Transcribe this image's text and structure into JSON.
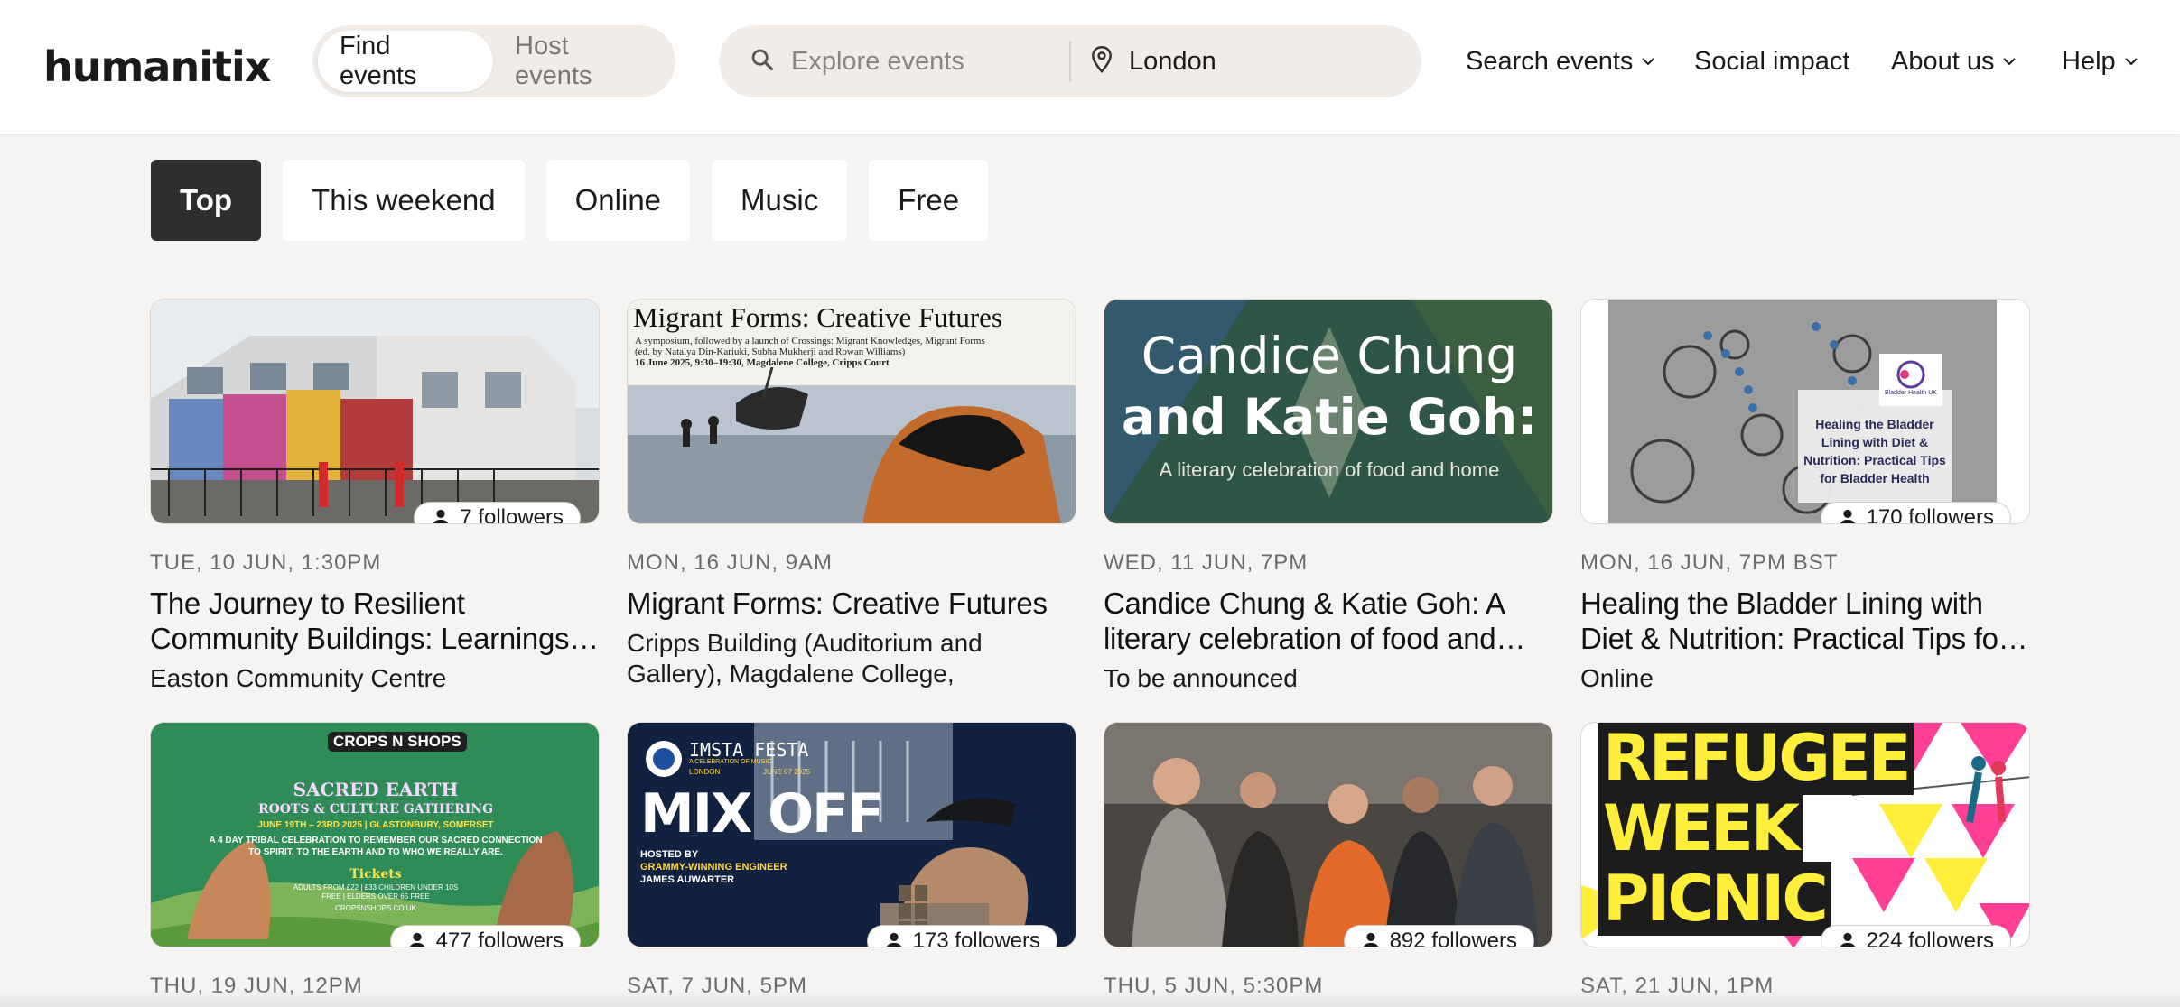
{
  "brand": {
    "logo_text": "humanitix"
  },
  "header": {
    "toggle": {
      "find": "Find events",
      "host": "Host events"
    },
    "search": {
      "placeholder": "Explore events",
      "location": "London"
    },
    "nav": {
      "search_events": "Search events",
      "social_impact": "Social impact",
      "about_us": "About us",
      "help": "Help"
    }
  },
  "filters": [
    "Top",
    "This weekend",
    "Online",
    "Music",
    "Free"
  ],
  "events": [
    {
      "date": "TUE, 10 JUN, 1:30PM",
      "title": "The Journey to Resilient Community Buildings: Learnings from Easton Community Centre",
      "venue": "Easton Community Centre",
      "followers": "7 followers"
    },
    {
      "date": "MON, 16 JUN, 9AM",
      "title": "Migrant Forms: Creative Futures",
      "venue": "Cripps Building (Auditorium and Gallery), Magdalene College,",
      "followers": "",
      "image_text": {
        "heading": "Migrant Forms: Creative Futures",
        "line1": "A symposium, followed by a launch of Crossings: Migrant Knowledges, Migrant Forms",
        "line2": "(ed. by Natalya Din-Kariuki, Subha Mukherji and Rowan Williams)",
        "line3": "16 June 2025, 9:30–19:30, Magdalene College, Cripps Court"
      }
    },
    {
      "date": "WED, 11 JUN, 7PM",
      "title": "Candice Chung & Katie Goh: A literary celebration of food and home",
      "venue": "To be announced",
      "followers": "",
      "image_text": {
        "line1": "Candice Chung",
        "line2": "and Katie Goh:",
        "sub": "A literary celebration of food and home"
      }
    },
    {
      "date": "MON, 16 JUN, 7PM BST",
      "title": "Healing the Bladder Lining with Diet & Nutrition: Practical Tips for Bladder Health",
      "venue": "Online",
      "followers": "170 followers",
      "image_text": {
        "org": "Bladder Health UK",
        "caption": "Healing the Bladder Lining with Diet & Nutrition: Practical Tips for Bladder Health"
      }
    },
    {
      "date": "THU, 19 JUN, 12PM",
      "followers": "477 followers",
      "image_text": {
        "brand": "CROPS N SHOPS",
        "title1": "SACRED EARTH",
        "title2": "ROOTS & CULTURE GATHERING",
        "dates": "JUNE 19TH – 23RD 2025 | GLASTONBURY, SOMERSET",
        "blurb": "A 4 DAY TRIBAL CELEBRATION TO REMEMBER OUR SACRED CONNECTION TO SPIRIT, TO THE EARTH AND TO WHO WE REALLY ARE.",
        "tickets": "Tickets",
        "prices": "ADULTS FROM £22 | £33 CHILDREN UNDER 10S FREE | ELDERS OVER 65 FREE",
        "site": "CROPSNSHOPS.CO.UK"
      }
    },
    {
      "date": "SAT, 7 JUN, 5PM",
      "followers": "173 followers",
      "image_text": {
        "brand": "IMSTA FESTA",
        "sub": "A CELEBRATION OF MUSIC",
        "city": "LONDON",
        "date": "JUNE 07 2025",
        "title": "MIX OFF",
        "hosted": "HOSTED BY",
        "host1": "GRAMMY-WINNING ENGINEER",
        "host2": "JAMES AUWARTER"
      }
    },
    {
      "date": "THU, 5 JUN, 5:30PM",
      "followers": "892 followers"
    },
    {
      "date": "SAT, 21 JUN, 1PM",
      "followers": "224 followers",
      "image_text": {
        "l1": "REFUGEE",
        "l2": "WEEK",
        "l3": "PICNIC"
      }
    }
  ],
  "colors": {
    "accent_dark": "#2f2d2f",
    "panel": "#f1ece7",
    "background": "#f5f4f3"
  }
}
